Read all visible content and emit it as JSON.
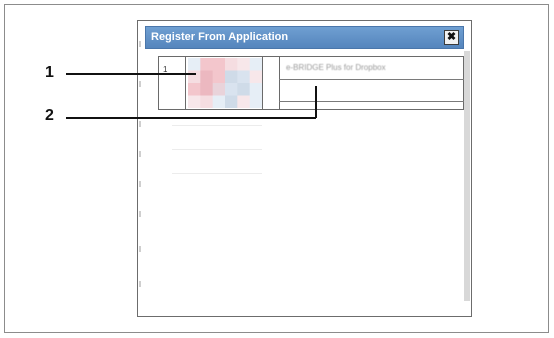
{
  "dialog": {
    "title": "Register From Application",
    "close_label": "✖",
    "row_number": "1",
    "application_name": "e-BRIDGE Plus for Dropbox"
  },
  "callouts": [
    "1",
    "2"
  ],
  "thumbnail": {
    "colors": [
      "#f3c6cc",
      "#ecb8c0",
      "#d9e3ef",
      "#e9d3da",
      "#f5dde1",
      "#cfdbe8",
      "#f7e7ea",
      "#e6eef6"
    ]
  }
}
